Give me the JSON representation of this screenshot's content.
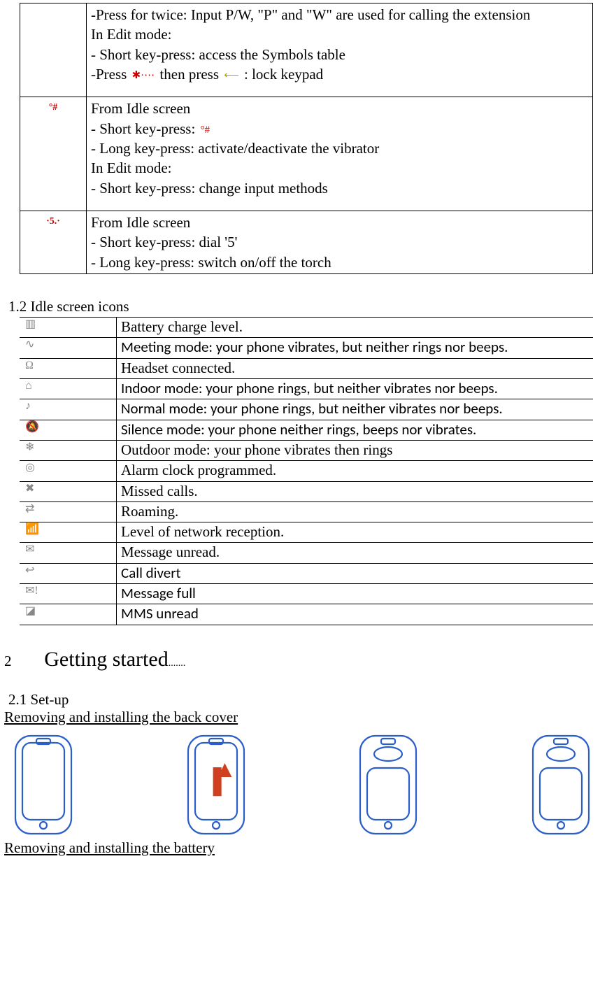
{
  "keyTable": [
    {
      "icon": "",
      "lines": [
        "-Press for twice: Input P/W, \"P\" and \"W\" are used for calling the extension",
        "In Edit mode:",
        "- Short key-press: access the Symbols table",
        "-Press __STAR__ then press __LOCK__ : lock keypad"
      ]
    },
    {
      "icon": "hash-icon",
      "iconGlyph": "°#",
      "lines": [
        "From Idle screen",
        "- Short key-press:   __HASH__",
        "- Long key-press: activate/deactivate the vibrator",
        "In Edit mode:",
        "- Short key-press: change input methods"
      ]
    },
    {
      "icon": "five-key-icon",
      "iconGlyph": "·5.·",
      "lines": [
        "From Idle screen",
        "- Short key-press: dial '5'",
        "- Long key-press: switch on/off the torch"
      ]
    }
  ],
  "section12": "1.2  Idle screen icons",
  "iconRows": [
    {
      "glyph": "battery-icon",
      "sym": "▥",
      "text": "Battery charge level.",
      "font": "serif"
    },
    {
      "glyph": "vibrate-icon",
      "sym": "∿",
      "text": "Meeting mode: your phone vibrates, but neither rings nor beeps.",
      "font": "calibri"
    },
    {
      "glyph": "headset-icon",
      "sym": "Ω",
      "text": "Headset connected.",
      "font": "serif"
    },
    {
      "glyph": "house-icon",
      "sym": "⌂",
      "text": "Indoor mode: your phone rings, but neither vibrates nor beeps.",
      "font": "calibri"
    },
    {
      "glyph": "note-icon",
      "sym": "♪",
      "text": "Normal mode: your phone rings, but neither vibrates nor beeps.",
      "font": "calibri"
    },
    {
      "glyph": "mute-icon",
      "sym": "🔕",
      "text": "Silence mode: your phone neither rings, beeps nor vibrates.",
      "font": "calibri"
    },
    {
      "glyph": "outdoor-icon",
      "sym": "❄",
      "text": "Outdoor mode: your phone vibrates then rings",
      "font": "serif"
    },
    {
      "glyph": "alarm-icon",
      "sym": "◎",
      "text": "Alarm clock programmed.",
      "font": "serif"
    },
    {
      "glyph": "missed-call-icon",
      "sym": "✖",
      "text": "Missed calls.",
      "font": "serif"
    },
    {
      "glyph": "roaming-icon",
      "sym": "⇄",
      "text": "Roaming.",
      "font": "serif"
    },
    {
      "glyph": "signal-icon",
      "sym": "📶",
      "text": "Level of network reception.",
      "font": "serif"
    },
    {
      "glyph": "message-icon",
      "sym": "✉",
      "text": "Message unread.",
      "font": "serif"
    },
    {
      "glyph": "divert-icon",
      "sym": "↩",
      "text": "Call divert",
      "font": "calibri"
    },
    {
      "glyph": "msgfull-icon",
      "sym": "✉!",
      "text": "Message full",
      "font": "calibri"
    },
    {
      "glyph": "mms-icon",
      "sym": "◪",
      "text": "MMS unread",
      "font": "calibri"
    }
  ],
  "chapter2": {
    "num": "2",
    "title": "Getting started",
    "dots": "......."
  },
  "section21": "2.1  Set-up",
  "removeCover": "Removing and installing the back cover",
  "removeBattery": "Removing and installing the battery",
  "inlineIcons": {
    "star": "✱·⋯",
    "lock": "⟵",
    "hash": "°#"
  }
}
